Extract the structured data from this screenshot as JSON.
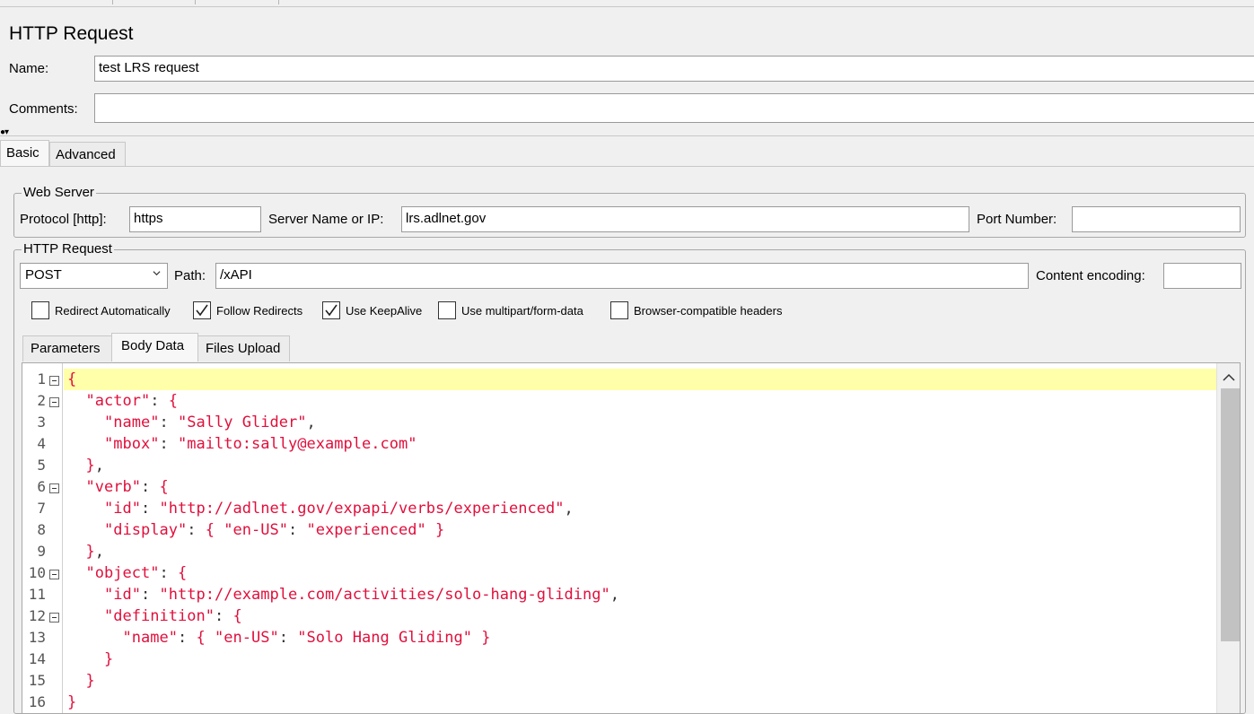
{
  "title": "HTTP Request",
  "name": {
    "label": "Name:",
    "value": "test LRS request"
  },
  "comments": {
    "label": "Comments:",
    "value": ""
  },
  "tabs": [
    {
      "label": "Basic",
      "active": true
    },
    {
      "label": "Advanced",
      "active": false
    }
  ],
  "web_server": {
    "legend": "Web Server",
    "protocol_label": "Protocol [http]:",
    "protocol_value": "https",
    "server_label": "Server Name or IP:",
    "server_value": "lrs.adlnet.gov",
    "port_label": "Port Number:",
    "port_value": ""
  },
  "http_request": {
    "legend": "HTTP Request",
    "method": "POST",
    "path_label": "Path:",
    "path_value": "/xAPI",
    "encoding_label": "Content encoding:",
    "encoding_value": ""
  },
  "checkboxes": [
    {
      "label": "Redirect Automatically",
      "checked": false
    },
    {
      "label": "Follow Redirects",
      "checked": true
    },
    {
      "label": "Use KeepAlive",
      "checked": true
    },
    {
      "label": "Use multipart/form-data",
      "checked": false
    },
    {
      "label": "Browser-compatible headers",
      "checked": false
    }
  ],
  "sub_tabs": [
    {
      "label": "Parameters",
      "active": false
    },
    {
      "label": "Body Data",
      "active": true
    },
    {
      "label": "Files Upload",
      "active": false
    }
  ],
  "body_lines": [
    {
      "n": "1",
      "fold": true,
      "code": "{"
    },
    {
      "n": "2",
      "fold": true,
      "code": "  \"actor\": {"
    },
    {
      "n": "3",
      "fold": false,
      "code": "    \"name\": \"Sally Glider\","
    },
    {
      "n": "4",
      "fold": false,
      "code": "    \"mbox\": \"mailto:sally@example.com\""
    },
    {
      "n": "5",
      "fold": false,
      "code": "  },"
    },
    {
      "n": "6",
      "fold": true,
      "code": "  \"verb\": {"
    },
    {
      "n": "7",
      "fold": false,
      "code": "    \"id\": \"http://adlnet.gov/expapi/verbs/experienced\","
    },
    {
      "n": "8",
      "fold": false,
      "code": "    \"display\": { \"en-US\": \"experienced\" }"
    },
    {
      "n": "9",
      "fold": false,
      "code": "  },"
    },
    {
      "n": "10",
      "fold": true,
      "code": "  \"object\": {"
    },
    {
      "n": "11",
      "fold": false,
      "code": "    \"id\": \"http://example.com/activities/solo-hang-gliding\","
    },
    {
      "n": "12",
      "fold": true,
      "code": "    \"definition\": {"
    },
    {
      "n": "13",
      "fold": false,
      "code": "      \"name\": { \"en-US\": \"Solo Hang Gliding\" }"
    },
    {
      "n": "14",
      "fold": false,
      "code": "    }"
    },
    {
      "n": "15",
      "fold": false,
      "code": "  }"
    },
    {
      "n": "16",
      "fold": false,
      "code": "}"
    }
  ]
}
